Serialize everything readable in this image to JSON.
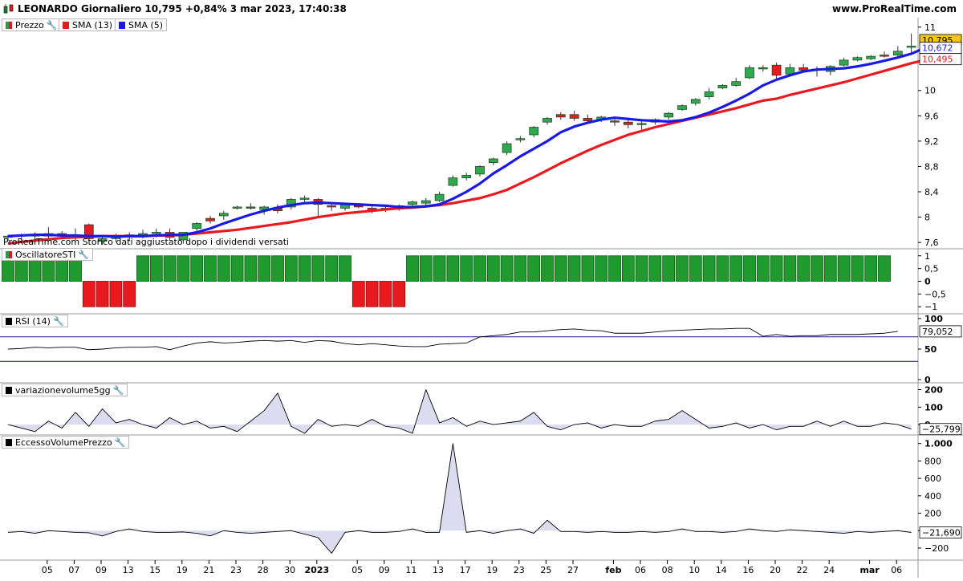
{
  "header": {
    "title": "LEONARDO Giornaliero 10,795 +0,84% 3 mar 2023, 17:40:38",
    "brand": "www.ProRealTime.com"
  },
  "price_panel": {
    "legend": [
      {
        "label": "Prezzo",
        "color": "#2e9b4a"
      },
      {
        "label": "SMA (13)",
        "color": "#e8191f"
      },
      {
        "label": "SMA (5)",
        "color": "#1a1ae6"
      }
    ],
    "note": "ProRealTime.com  Storico dati aggiustato dopo i dividendi versati",
    "y_ticks": [
      "11",
      "10",
      "9,6",
      "9,2",
      "8,8",
      "8,4",
      "8",
      "7,6"
    ],
    "last_price": "10,795",
    "sma5_value": "10,672",
    "sma13_value": "10,495"
  },
  "osc_panel": {
    "legend": "OscillatoreSTI",
    "y_ticks": [
      "1",
      "0,5",
      "0",
      "−0,5",
      "−1"
    ]
  },
  "rsi_panel": {
    "legend": "RSI (14)",
    "y_ticks": [
      "100",
      "50",
      "0"
    ],
    "value": "79,052"
  },
  "vol_panel": {
    "legend": "variazionevolume5gg",
    "y_ticks": [
      "200",
      "100",
      "0"
    ],
    "value": "−25,799"
  },
  "evp_panel": {
    "legend": "EccessoVolumePrezzo",
    "y_ticks": [
      "1.000",
      "800",
      "600",
      "400",
      "200",
      "0",
      "−200"
    ],
    "value": "−21,690"
  },
  "x_axis": {
    "labels": [
      {
        "t": "05",
        "i": 1
      },
      {
        "t": "07",
        "i": 3
      },
      {
        "t": "09",
        "i": 5
      },
      {
        "t": "13",
        "i": 7
      },
      {
        "t": "15",
        "i": 9
      },
      {
        "t": "19",
        "i": 11
      },
      {
        "t": "21",
        "i": 13
      },
      {
        "t": "23",
        "i": 15
      },
      {
        "t": "28",
        "i": 17
      },
      {
        "t": "30",
        "i": 19
      },
      {
        "t": "2023",
        "i": 21,
        "bold": true
      },
      {
        "t": "05",
        "i": 24
      },
      {
        "t": "09",
        "i": 26
      },
      {
        "t": "11",
        "i": 28
      },
      {
        "t": "13",
        "i": 30
      },
      {
        "t": "17",
        "i": 32
      },
      {
        "t": "19",
        "i": 34
      },
      {
        "t": "23",
        "i": 36
      },
      {
        "t": "25",
        "i": 38
      },
      {
        "t": "27",
        "i": 40
      },
      {
        "t": "feb",
        "i": 43,
        "bold": true
      },
      {
        "t": "06",
        "i": 45
      },
      {
        "t": "08",
        "i": 47
      },
      {
        "t": "10",
        "i": 49
      },
      {
        "t": "14",
        "i": 51
      },
      {
        "t": "16",
        "i": 53
      },
      {
        "t": "20",
        "i": 55
      },
      {
        "t": "22",
        "i": 57
      },
      {
        "t": "24",
        "i": 59
      },
      {
        "t": "mar",
        "i": 62,
        "bold": true
      },
      {
        "t": "06",
        "i": 64
      }
    ]
  },
  "chart_data": [
    {
      "type": "candlestick",
      "series": [
        {
          "name": "Prezzo",
          "ohlc": [
            [
              7.68,
              7.72,
              7.62,
              7.7
            ],
            [
              7.7,
              7.74,
              7.64,
              7.72
            ],
            [
              7.72,
              7.76,
              7.66,
              7.7
            ],
            [
              7.7,
              7.84,
              7.64,
              7.74
            ],
            [
              7.74,
              7.78,
              7.66,
              7.7
            ],
            [
              7.7,
              7.82,
              7.64,
              7.72
            ],
            [
              7.88,
              7.9,
              7.62,
              7.66
            ],
            [
              7.62,
              7.68,
              7.56,
              7.66
            ],
            [
              7.66,
              7.74,
              7.6,
              7.7
            ],
            [
              7.7,
              7.76,
              7.62,
              7.72
            ],
            [
              7.72,
              7.8,
              7.66,
              7.74
            ],
            [
              7.74,
              7.82,
              7.68,
              7.76
            ],
            [
              7.76,
              7.82,
              7.64,
              7.68
            ],
            [
              7.64,
              7.72,
              7.58,
              7.76
            ],
            [
              7.82,
              7.92,
              7.76,
              7.9
            ],
            [
              7.98,
              8.02,
              7.9,
              7.94
            ],
            [
              8.02,
              8.1,
              7.96,
              8.06
            ],
            [
              8.14,
              8.18,
              8.12,
              8.16
            ],
            [
              8.16,
              8.22,
              8.12,
              8.14
            ],
            [
              8.12,
              8.18,
              8.04,
              8.16
            ],
            [
              8.14,
              8.2,
              8.06,
              8.1
            ],
            [
              8.16,
              8.3,
              8.12,
              8.28
            ],
            [
              8.28,
              8.34,
              8.22,
              8.3
            ],
            [
              8.28,
              8.3,
              8.0,
              8.2
            ],
            [
              8.18,
              8.24,
              8.1,
              8.16
            ],
            [
              8.14,
              8.22,
              8.1,
              8.2
            ],
            [
              8.18,
              8.2,
              8.14,
              8.16
            ],
            [
              8.14,
              8.2,
              8.06,
              8.1
            ],
            [
              8.12,
              8.16,
              8.08,
              8.14
            ],
            [
              8.14,
              8.2,
              8.1,
              8.18
            ],
            [
              8.2,
              8.26,
              8.16,
              8.24
            ],
            [
              8.22,
              8.3,
              8.18,
              8.26
            ],
            [
              8.26,
              8.4,
              8.24,
              8.36
            ],
            [
              8.5,
              8.66,
              8.48,
              8.62
            ],
            [
              8.62,
              8.7,
              8.58,
              8.66
            ],
            [
              8.68,
              8.82,
              8.64,
              8.8
            ],
            [
              8.86,
              8.94,
              8.82,
              8.92
            ],
            [
              9.02,
              9.2,
              8.98,
              9.16
            ],
            [
              9.22,
              9.28,
              9.18,
              9.24
            ],
            [
              9.3,
              9.44,
              9.26,
              9.42
            ],
            [
              9.5,
              9.58,
              9.46,
              9.56
            ],
            [
              9.62,
              9.66,
              9.54,
              9.58
            ],
            [
              9.62,
              9.68,
              9.52,
              9.56
            ],
            [
              9.56,
              9.62,
              9.48,
              9.52
            ],
            [
              9.54,
              9.6,
              9.5,
              9.58
            ],
            [
              9.52,
              9.58,
              9.44,
              9.5
            ],
            [
              9.5,
              9.56,
              9.4,
              9.46
            ],
            [
              9.46,
              9.52,
              9.38,
              9.48
            ],
            [
              9.5,
              9.56,
              9.46,
              9.54
            ],
            [
              9.58,
              9.66,
              9.54,
              9.64
            ],
            [
              9.7,
              9.78,
              9.68,
              9.76
            ],
            [
              9.8,
              9.88,
              9.76,
              9.86
            ],
            [
              9.9,
              10.04,
              9.86,
              9.98
            ],
            [
              10.04,
              10.1,
              10.02,
              10.08
            ],
            [
              10.08,
              10.2,
              10.06,
              10.14
            ],
            [
              10.2,
              10.4,
              10.18,
              10.36
            ],
            [
              10.34,
              10.4,
              10.3,
              10.36
            ],
            [
              10.4,
              10.44,
              10.18,
              10.24
            ],
            [
              10.26,
              10.42,
              10.22,
              10.36
            ],
            [
              10.36,
              10.42,
              10.28,
              10.32
            ],
            [
              10.32,
              10.38,
              10.22,
              10.34
            ],
            [
              10.3,
              10.4,
              10.24,
              10.38
            ],
            [
              10.4,
              10.52,
              10.38,
              10.48
            ],
            [
              10.48,
              10.54,
              10.46,
              10.52
            ],
            [
              10.5,
              10.56,
              10.48,
              10.54
            ],
            [
              10.56,
              10.62,
              10.52,
              10.54
            ],
            [
              10.56,
              10.7,
              10.54,
              10.62
            ],
            [
              10.7,
              10.9,
              10.6,
              10.7
            ],
            [
              10.74,
              10.86,
              10.68,
              10.795
            ]
          ]
        },
        {
          "name": "SMA (13)",
          "values": [
            7.58,
            7.61,
            7.63,
            7.65,
            7.67,
            7.68,
            7.69,
            7.7,
            7.7,
            7.7,
            7.7,
            7.71,
            7.71,
            7.72,
            7.74,
            7.76,
            7.78,
            7.8,
            7.83,
            7.86,
            7.89,
            7.92,
            7.96,
            8.0,
            8.03,
            8.06,
            8.08,
            8.1,
            8.12,
            8.14,
            8.15,
            8.17,
            8.19,
            8.22,
            8.26,
            8.3,
            8.36,
            8.43,
            8.53,
            8.63,
            8.74,
            8.85,
            8.95,
            9.05,
            9.14,
            9.22,
            9.3,
            9.36,
            9.42,
            9.47,
            9.52,
            9.57,
            9.62,
            9.67,
            9.72,
            9.78,
            9.84,
            9.87,
            9.93,
            9.98,
            10.03,
            10.08,
            10.13,
            10.19,
            10.25,
            10.31,
            10.37,
            10.43,
            10.48
          ]
        },
        {
          "name": "SMA (5)",
          "values": [
            7.7,
            7.71,
            7.72,
            7.72,
            7.71,
            7.71,
            7.7,
            7.7,
            7.69,
            7.7,
            7.7,
            7.71,
            7.72,
            7.72,
            7.76,
            7.82,
            7.9,
            7.97,
            8.04,
            8.1,
            8.15,
            8.19,
            8.22,
            8.23,
            8.22,
            8.21,
            8.2,
            8.19,
            8.18,
            8.16,
            8.16,
            8.17,
            8.2,
            8.29,
            8.4,
            8.53,
            8.69,
            8.82,
            8.96,
            9.08,
            9.2,
            9.34,
            9.43,
            9.49,
            9.54,
            9.57,
            9.55,
            9.53,
            9.52,
            9.51,
            9.53,
            9.58,
            9.65,
            9.74,
            9.84,
            9.95,
            10.08,
            10.17,
            10.24,
            10.3,
            10.33,
            10.34,
            10.35,
            10.38,
            10.42,
            10.47,
            10.52,
            10.58,
            10.672
          ]
        }
      ],
      "ylim": [
        7.5,
        11.15
      ]
    },
    {
      "type": "bar",
      "name": "OscillatoreSTI",
      "values": [
        1,
        1,
        1,
        1,
        1,
        1,
        -1,
        -1,
        -1,
        -1,
        1,
        1,
        1,
        1,
        1,
        1,
        1,
        1,
        1,
        1,
        1,
        1,
        1,
        1,
        1,
        1,
        -1,
        -1,
        -1,
        -1,
        1,
        1,
        1,
        1,
        1,
        1,
        1,
        1,
        1,
        1,
        1,
        1,
        1,
        1,
        1,
        1,
        1,
        1,
        1,
        1,
        1,
        1,
        1,
        1,
        1,
        1,
        1,
        1,
        1,
        1,
        1,
        1,
        1,
        1,
        1,
        1
      ],
      "ylim": [
        -1.15,
        1.15
      ]
    },
    {
      "type": "line",
      "name": "RSI (14)",
      "values": [
        50,
        51,
        53,
        52,
        53,
        53,
        49,
        50,
        52,
        53,
        53,
        54,
        49,
        55,
        60,
        62,
        60,
        61,
        63,
        64,
        63,
        64,
        61,
        64,
        63,
        59,
        57,
        59,
        57,
        55,
        54,
        54,
        58,
        59,
        60,
        70,
        72,
        74,
        78,
        78,
        80,
        82,
        83,
        81,
        80,
        76,
        76,
        76,
        78,
        80,
        81,
        82,
        83,
        83,
        84,
        84,
        71,
        74,
        71,
        72,
        72,
        74,
        74,
        74,
        75,
        76,
        79.052
      ],
      "ylim": [
        0,
        100
      ],
      "hlines": [
        70,
        30
      ]
    },
    {
      "type": "area",
      "name": "variazionevolume5gg",
      "values": [
        0,
        -20,
        -40,
        20,
        -20,
        70,
        -10,
        90,
        10,
        30,
        0,
        -20,
        40,
        0,
        20,
        -20,
        -10,
        -40,
        20,
        80,
        180,
        -10,
        -50,
        30,
        -10,
        0,
        -10,
        30,
        -10,
        -20,
        -50,
        200,
        10,
        40,
        -10,
        20,
        0,
        10,
        20,
        70,
        -10,
        -30,
        0,
        10,
        -20,
        0,
        -10,
        -10,
        20,
        30,
        80,
        30,
        -20,
        -10,
        10,
        -20,
        0,
        -30,
        -10,
        -10,
        20,
        -10,
        20,
        -10,
        -10,
        10,
        0,
        -25.799
      ],
      "ylim": [
        -50,
        230
      ]
    },
    {
      "type": "area",
      "name": "EccessoVolumePrezzo",
      "values": [
        -20,
        -10,
        -30,
        0,
        -10,
        -20,
        -25,
        -60,
        -10,
        20,
        -10,
        -20,
        -20,
        -15,
        -30,
        -60,
        0,
        -20,
        -30,
        -20,
        -10,
        0,
        -40,
        -80,
        -260,
        -20,
        0,
        -20,
        -20,
        -10,
        20,
        -20,
        -20,
        1000,
        -20,
        0,
        -30,
        0,
        20,
        -30,
        120,
        -10,
        -10,
        -20,
        -10,
        -20,
        -20,
        -10,
        -20,
        -10,
        20,
        -10,
        -10,
        -20,
        -10,
        20,
        0,
        -10,
        10,
        0,
        -10,
        -20,
        -30,
        -10,
        -20,
        -10,
        0,
        -21.69
      ],
      "ylim": [
        -320,
        1080
      ]
    }
  ]
}
